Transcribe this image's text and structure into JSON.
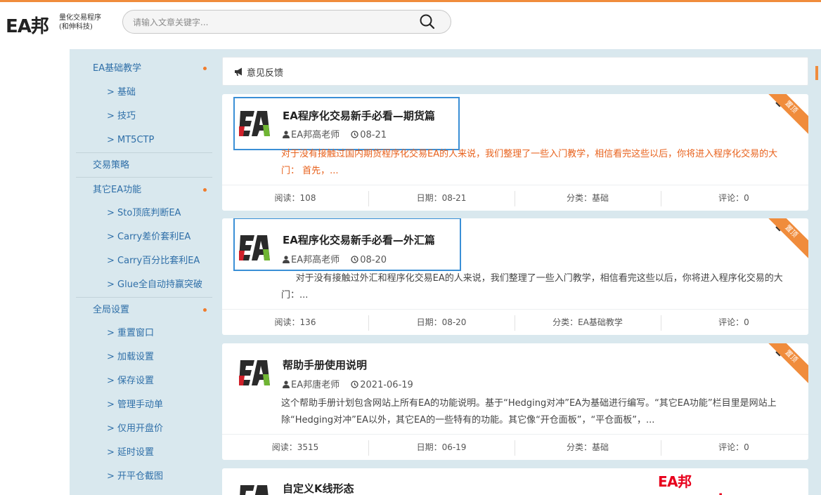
{
  "header": {
    "logo_mark": "EA邦",
    "logo_line1": "量化交易程序",
    "logo_line2": "(和伸科技)",
    "search_placeholder": "请输入文章关键字..."
  },
  "sidebar": {
    "items": [
      {
        "type": "cat",
        "label": "EA基础教学",
        "dot": true,
        "divided": false
      },
      {
        "type": "sub",
        "label": "> 基础"
      },
      {
        "type": "sub",
        "label": "> 技巧"
      },
      {
        "type": "sub",
        "label": "> MT5CTP"
      },
      {
        "type": "cat",
        "label": "交易策略",
        "dot": false,
        "divided": true
      },
      {
        "type": "cat",
        "label": "其它EA功能",
        "dot": true,
        "divided": true
      },
      {
        "type": "sub",
        "label": "> Sto顶底判断EA"
      },
      {
        "type": "sub",
        "label": "> Carry差价套利EA"
      },
      {
        "type": "sub",
        "label": "> Carry百分比套利EA"
      },
      {
        "type": "sub",
        "label": "> Glue全自动持赢突破"
      },
      {
        "type": "cat",
        "label": "全局设置",
        "dot": true,
        "divided": true
      },
      {
        "type": "sub",
        "label": "> 重置窗口"
      },
      {
        "type": "sub",
        "label": "> 加载设置"
      },
      {
        "type": "sub",
        "label": "> 保存设置"
      },
      {
        "type": "sub",
        "label": "> 管理手动单"
      },
      {
        "type": "sub",
        "label": "> 仅用开盘价"
      },
      {
        "type": "sub",
        "label": "> 延时设置"
      },
      {
        "type": "sub",
        "label": "> 开平仓截图"
      }
    ]
  },
  "notice": {
    "label": "意见反馈"
  },
  "articles": [
    {
      "title": "EA程序化交易新手必看—期货篇",
      "author": "EA邦高老师",
      "date": "08-21",
      "excerpt": "对于没有接触过国内期货程序化交易EA的人来说，我们整理了一些入门教学，相信看完这些以后，你将进入程序化交易的大门：         首先，...",
      "excerpt_orange": true,
      "ribbon": "置顶",
      "stats": {
        "reads": "阅读：108",
        "date": "日期：08-21",
        "category": "分类：基础",
        "comments": "评论：0"
      }
    },
    {
      "title": "EA程序化交易新手必看—外汇篇",
      "author": "EA邦高老师",
      "date": "08-20",
      "excerpt": "     对于没有接触过外汇和程序化交易EA的人来说，我们整理了一些入门教学，相信看完这些以后，你将进入程序化交易的大门：...",
      "excerpt_orange": false,
      "ribbon": "置顶",
      "stats": {
        "reads": "阅读：136",
        "date": "日期：08-20",
        "category": "分类：EA基础教学",
        "comments": "评论：0"
      }
    },
    {
      "title": "帮助手册使用说明",
      "author": "EA邦唐老师",
      "date": "2021-06-19",
      "excerpt": "这个帮助手册计划包含网站上所有EA的功能说明。基于“Hedging对冲”EA为基础进行编写。“其它EA功能”栏目里是网站上除“Hedging对冲”EA以外，其它EA的一些特有的功能。其它像“开仓面板”，“平仓面板”，...",
      "excerpt_orange": false,
      "ribbon": "置顶",
      "stats": {
        "reads": "阅读：3515",
        "date": "日期：06-19",
        "category": "分类：基础",
        "comments": "评论：0"
      }
    },
    {
      "title": "自定义K线形态"
    }
  ],
  "watermark": "EA邦www.eabang.com",
  "colors": {
    "accent": "#f08c3c",
    "link": "#2f6fa8",
    "band": "#d9e8ee",
    "highlight": "#3a8fd6",
    "orange_text": "#e8621d"
  }
}
